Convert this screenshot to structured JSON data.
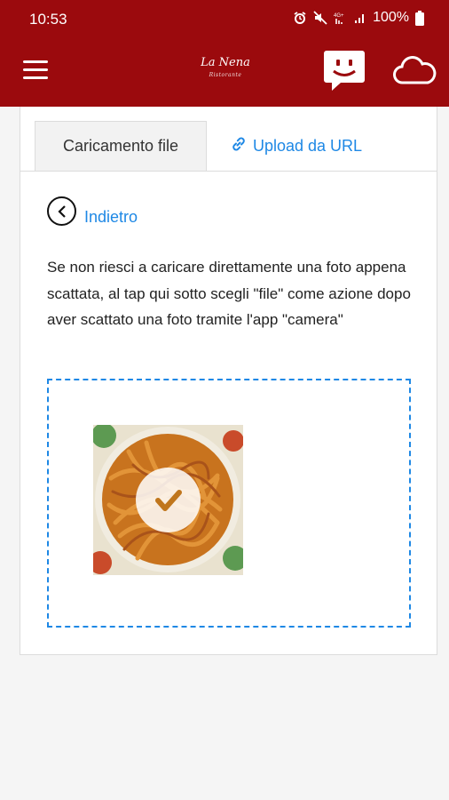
{
  "statusbar": {
    "time": "10:53",
    "battery": "100%",
    "network": "4G+ LTE+"
  },
  "appbar": {
    "logo_text": "La Nena",
    "logo_tagline": "Ristorante",
    "icons": [
      "menu-icon",
      "chat-smiley-icon",
      "cloud-icon"
    ]
  },
  "tabs": {
    "file_upload": "Caricamento file",
    "url_upload": "Upload da URL"
  },
  "back": {
    "label": "Indietro"
  },
  "info_text": "Se non riesci a caricare direttamente una foto appena scattata, al tap qui sotto scegli \"file\" come azione dopo aver scattato una foto tramite l'app \"camera\"",
  "colors": {
    "brand": "#9b0a0d",
    "accent": "#1e88e5"
  }
}
